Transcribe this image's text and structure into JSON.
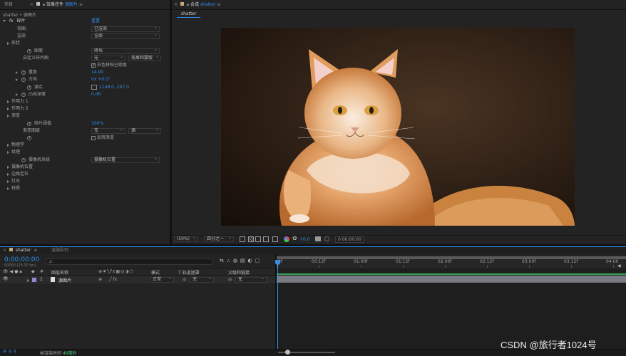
{
  "top": {
    "project_tab": "项目",
    "effect_tab_prefix": "效果控件",
    "effect_tab_layer": "源图片",
    "comp_tab_prefix": "合成",
    "comp_tab_name": "shatter",
    "comp_subtab": "shatter",
    "breadcrumb": "shatter • 源图片"
  },
  "effect": {
    "fx_name": "碎片",
    "reset": "重置",
    "rows": [
      {
        "label": "视图",
        "value": "已渲染"
      },
      {
        "label": "渲染",
        "value": "全部"
      },
      {
        "label": "形状"
      },
      {
        "label": "图案",
        "value": "砖块"
      },
      {
        "label": "自定义碎片图",
        "value": "无",
        "value2": "效果和蒙版"
      },
      {
        "label": "",
        "value": "白色拼贴已修复"
      },
      {
        "label": "重复",
        "value": "14.90"
      },
      {
        "label": "方向",
        "value": "0x +0.0°"
      },
      {
        "label": "源点",
        "value": "1148.0, 207.0"
      },
      {
        "label": "凸出深度",
        "value": "0.06"
      },
      {
        "label": "作用力 1"
      },
      {
        "label": "作用力 2"
      },
      {
        "label": "渐变"
      },
      {
        "label": "碎片阈值",
        "value": "100%"
      },
      {
        "label": "渐变图层",
        "value": "无",
        "value2": "源"
      },
      {
        "label": "",
        "value": "反转渐变"
      },
      {
        "label": "物理学"
      },
      {
        "label": "纹理"
      },
      {
        "label": "摄像机系统",
        "value": "摄像机位置"
      },
      {
        "label": "摄像机位置"
      },
      {
        "label": "边角定位"
      },
      {
        "label": "灯光"
      },
      {
        "label": "材质"
      }
    ]
  },
  "viewer": {
    "zoom": "(50%)",
    "resolution": "四分之一",
    "exposure": "+0.0",
    "timecode": "0:00:00:00"
  },
  "timeline": {
    "tab_comp": "shatter",
    "tab_render": "渲染队列",
    "timecode": "0:00:00:00",
    "frame_info": "00000 (25.00 fps)",
    "search_placeholder": "ρ.",
    "col_layer_name": "图层名称",
    "col_mode": "模式",
    "col_trkmat": "T  轨道遮罩",
    "col_parent": "父级和链接",
    "layer_num": "1",
    "layer_name": "源图片",
    "layer_mode": "正常",
    "layer_trkmat": "无",
    "layer_parent": "无",
    "ruler": [
      "0f",
      "00:12f",
      "01:00f",
      "01:12f",
      "02:00f",
      "02:12f",
      "03:00f",
      "03:12f",
      "04:00"
    ],
    "footer_label": "帧渲染时间",
    "footer_value": "46毫秒"
  },
  "watermark": "CSDN @旅行者1024号",
  "colors": {
    "accent": "#2d8ceb",
    "playhead": "#3a8ee6",
    "layer_bar": "#7a7a84",
    "work_area": "#3aa25a"
  }
}
